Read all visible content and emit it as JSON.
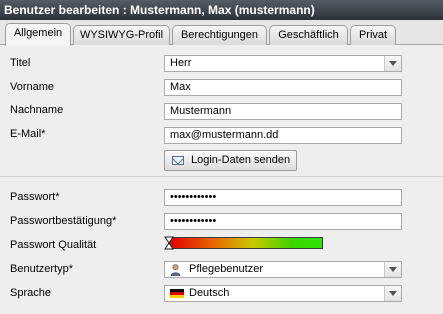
{
  "window": {
    "title": "Benutzer bearbeiten : Mustermann, Max (mustermann)"
  },
  "tabs": [
    {
      "label": "Allgemein",
      "active": true
    },
    {
      "label": "WYSIWYG-Profil",
      "active": false
    },
    {
      "label": "Berechtigungen",
      "active": false
    },
    {
      "label": "Geschäftlich",
      "active": false
    },
    {
      "label": "Privat",
      "active": false
    }
  ],
  "form": {
    "titel": {
      "label": "Titel",
      "value": "Herr"
    },
    "vorname": {
      "label": "Vorname",
      "value": "Max"
    },
    "nachname": {
      "label": "Nachname",
      "value": "Mustermann"
    },
    "email": {
      "label": "E-Mail*",
      "value": "max@mustermann.dd"
    },
    "send_login_button": {
      "label": "Login-Daten senden"
    },
    "passwort": {
      "label": "Passwort*",
      "value": "••••••••••••"
    },
    "passwort_bestaetigung": {
      "label": "Passwortbestätigung*",
      "value": "••••••••••••"
    },
    "passwort_qualitaet": {
      "label": "Passwort Qualität"
    },
    "benutzertyp": {
      "label": "Benutzertyp*",
      "value": "Pflegebenutzer",
      "icon": "user-icon"
    },
    "sprache": {
      "label": "Sprache",
      "value": "Deutsch",
      "icon": "german-flag-icon"
    }
  },
  "colors": {
    "titlebar": "#3a4048",
    "content_bg": "#eeeeee",
    "quality_low": "#e10000",
    "quality_high": "#2ce300"
  }
}
